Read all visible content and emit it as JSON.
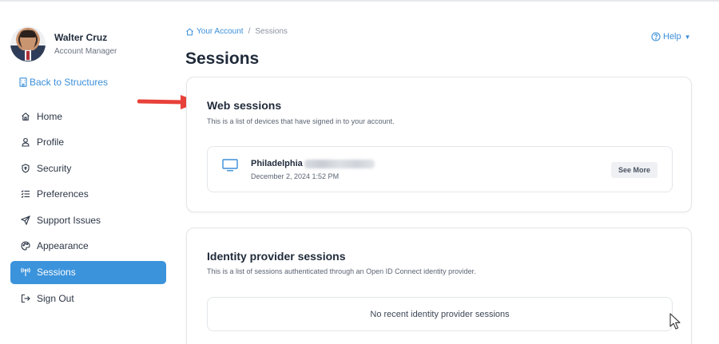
{
  "user": {
    "name": "Walter Cruz",
    "role": "Account Manager"
  },
  "sidebar": {
    "back_link": "Back to Structures",
    "items": [
      {
        "label": "Home",
        "icon": "home-icon",
        "active": false
      },
      {
        "label": "Profile",
        "icon": "user-icon",
        "active": false
      },
      {
        "label": "Security",
        "icon": "shield-icon",
        "active": false
      },
      {
        "label": "Preferences",
        "icon": "list-settings-icon",
        "active": false
      },
      {
        "label": "Support Issues",
        "icon": "send-icon",
        "active": false
      },
      {
        "label": "Appearance",
        "icon": "palette-icon",
        "active": false
      },
      {
        "label": "Sessions",
        "icon": "broadcast-icon",
        "active": true
      },
      {
        "label": "Sign Out",
        "icon": "sign-out-icon",
        "active": false
      }
    ]
  },
  "breadcrumb": {
    "root": "Your Account",
    "separator": "/",
    "current": "Sessions"
  },
  "help": {
    "label": "Help"
  },
  "page": {
    "title": "Sessions"
  },
  "web_sessions": {
    "title": "Web sessions",
    "description": "This is a list of devices that have signed in to your account.",
    "sessions": [
      {
        "location": "Philadelphia",
        "date": "December 2, 2024 1:52 PM",
        "action": "See More",
        "icon": "monitor-icon"
      }
    ]
  },
  "idp_sessions": {
    "title": "Identity provider sessions",
    "description": "This is a list of sessions authenticated through an Open ID Connect identity provider.",
    "empty_message": "No recent identity provider sessions"
  },
  "colors": {
    "accent": "#3b93dc",
    "link": "#3b8fd9",
    "annotation_arrow": "#e8413a"
  }
}
